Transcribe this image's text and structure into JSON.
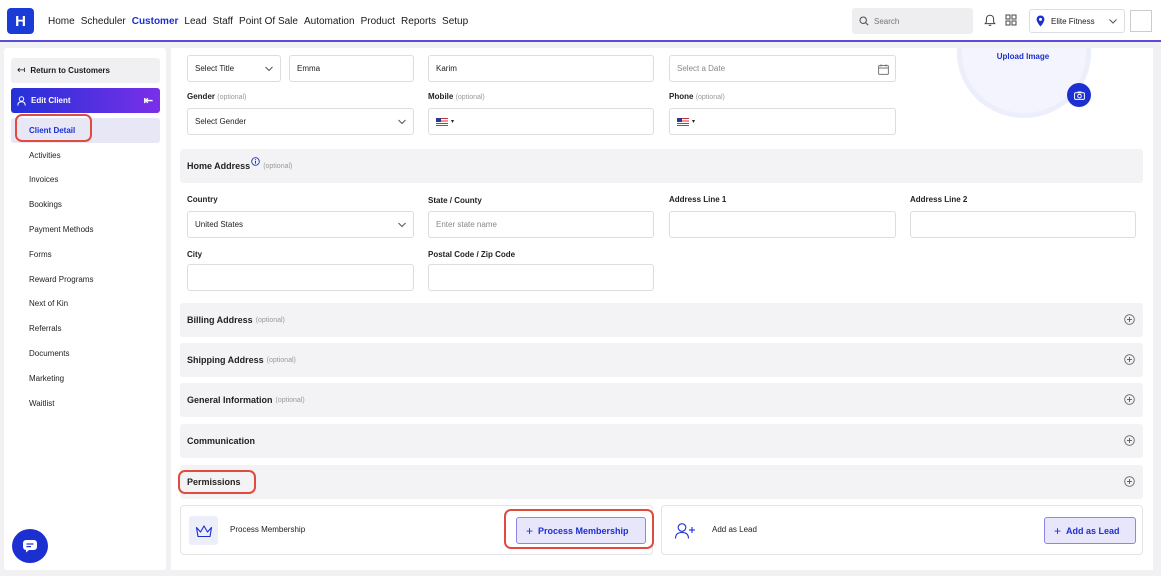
{
  "brand": {
    "logo_letter": "H",
    "accent": "#1c2fd1",
    "gradient_start": "#2431d8",
    "gradient_end": "#7a2fe8",
    "highlight": "#e04b3f"
  },
  "nav": {
    "items": [
      "Home",
      "Scheduler",
      "Customer",
      "Lead",
      "Staff",
      "Point Of Sale",
      "Automation",
      "Product",
      "Reports",
      "Setup"
    ],
    "active": "Customer"
  },
  "header": {
    "search_placeholder": "Search",
    "location": "Elite Fitness"
  },
  "sidebar": {
    "return_label": "Return to Customers",
    "edit_client_label": "Edit Client",
    "items": [
      "Client Detail",
      "Activities",
      "Invoices",
      "Bookings",
      "Payment Methods",
      "Forms",
      "Reward Programs",
      "Next of Kin",
      "Referrals",
      "Documents",
      "Marketing",
      "Waitlist"
    ],
    "active_item": "Client Detail"
  },
  "form": {
    "title_select": "Select Title",
    "first_name": "Emma",
    "last_name": "Karim",
    "dob_placeholder": "Select a Date",
    "gender_label": "Gender",
    "gender_select": "Select Gender",
    "mobile_label": "Mobile",
    "phone_label": "Phone",
    "optional": "(optional)",
    "upload_image": "Upload Image"
  },
  "home_address": {
    "title": "Home Address",
    "country_label": "Country",
    "country_value": "United States",
    "state_label": "State / County",
    "state_placeholder": "Enter state name",
    "address1_label": "Address Line 1",
    "address2_label": "Address Line 2",
    "city_label": "City",
    "postal_label": "Postal Code / Zip Code"
  },
  "sections": {
    "billing": "Billing Address",
    "shipping": "Shipping Address",
    "general": "General Information",
    "communication": "Communication",
    "permissions": "Permissions"
  },
  "permissions": {
    "membership_title": "Process Membership",
    "membership_button": "Process Membership",
    "lead_title": "Add as Lead",
    "lead_button": "Add as Lead"
  }
}
